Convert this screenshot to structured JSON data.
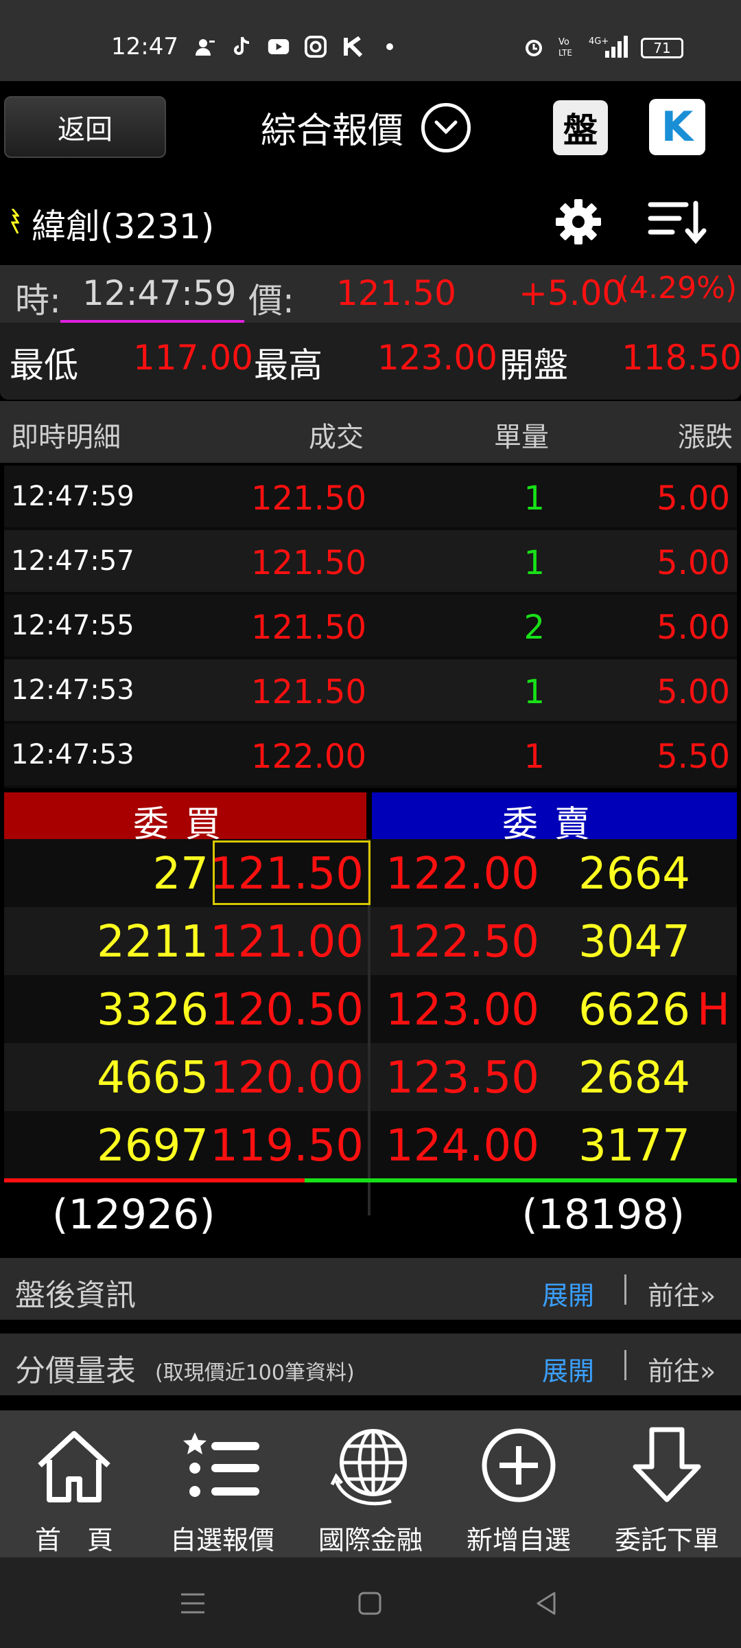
{
  "status_bar": {
    "time": "12:47",
    "battery": "71",
    "icons": [
      "contacts-icon",
      "tiktok-icon",
      "youtube-icon",
      "camera-icon",
      "k-icon",
      "dot-icon"
    ],
    "right_icons": [
      "alarm-icon",
      "volte-icon",
      "signal-4g-icon"
    ]
  },
  "header": {
    "back_label": "返回",
    "title": "綜合報價",
    "pan_label": "盤",
    "k_label": "K"
  },
  "stock": {
    "name": "緯創(3231)"
  },
  "quote": {
    "time_label": "時:",
    "time": "12:47:59",
    "price_label": "價:",
    "price": "121.50",
    "change": "+5.00",
    "change_pct": "(4.29%)",
    "low_label": "最低",
    "low": "117.00",
    "high_label": "最高",
    "high": "123.00",
    "open_label": "開盤",
    "open": "118.50"
  },
  "ticks": {
    "header": {
      "title": "即時明細",
      "price": "成交",
      "vol": "單量",
      "chg": "漲跌"
    },
    "rows": [
      {
        "time": "12:47:59",
        "price": "121.50",
        "vol": "1",
        "chg": "5.00"
      },
      {
        "time": "12:47:57",
        "price": "121.50",
        "vol": "1",
        "chg": "5.00"
      },
      {
        "time": "12:47:55",
        "price": "121.50",
        "vol": "2",
        "chg": "5.00"
      },
      {
        "time": "12:47:53",
        "price": "121.50",
        "vol": "1",
        "chg": "5.00"
      },
      {
        "time": "12:47:53",
        "price": "122.00",
        "vol": "1",
        "chg": "5.50"
      }
    ],
    "vol_colors": [
      "#18e018",
      "#18e018",
      "#18e018",
      "#18e018",
      "#ff1010"
    ]
  },
  "book": {
    "bid_label": "委買",
    "ask_label": "委賣",
    "rows": [
      {
        "bid_qty": "27",
        "bid_price": "121.50",
        "ask_price": "122.00",
        "ask_qty": "2664",
        "flag": ""
      },
      {
        "bid_qty": "2211",
        "bid_price": "121.00",
        "ask_price": "122.50",
        "ask_qty": "3047",
        "flag": ""
      },
      {
        "bid_qty": "3326",
        "bid_price": "120.50",
        "ask_price": "123.00",
        "ask_qty": "6626",
        "flag": "H"
      },
      {
        "bid_qty": "4665",
        "bid_price": "120.00",
        "ask_price": "123.50",
        "ask_qty": "2684",
        "flag": ""
      },
      {
        "bid_qty": "2697",
        "bid_price": "119.50",
        "ask_price": "124.00",
        "ask_qty": "3177",
        "flag": ""
      }
    ],
    "total_bid": "(12926)",
    "total_ask": "(18198)"
  },
  "sections": [
    {
      "title": "盤後資訊",
      "note": "",
      "expand": "展開",
      "go": "前往»"
    },
    {
      "title": "分價量表",
      "note": "(取現價近100筆資料)",
      "expand": "展開",
      "go": "前往»"
    }
  ],
  "bottom_nav": [
    {
      "label": "首　頁",
      "icon": "home-icon"
    },
    {
      "label": "自選報價",
      "icon": "watchlist-icon"
    },
    {
      "label": "國際金融",
      "icon": "globe-icon"
    },
    {
      "label": "新增自選",
      "icon": "add-circle-icon"
    },
    {
      "label": "委託下單",
      "icon": "download-order-icon"
    }
  ],
  "colors": {
    "up": "#ff1010",
    "down": "#18e018",
    "qty": "#ffff20",
    "bid_header": "#a80000",
    "ask_header": "#0000b8",
    "link": "#3aa0ff"
  }
}
